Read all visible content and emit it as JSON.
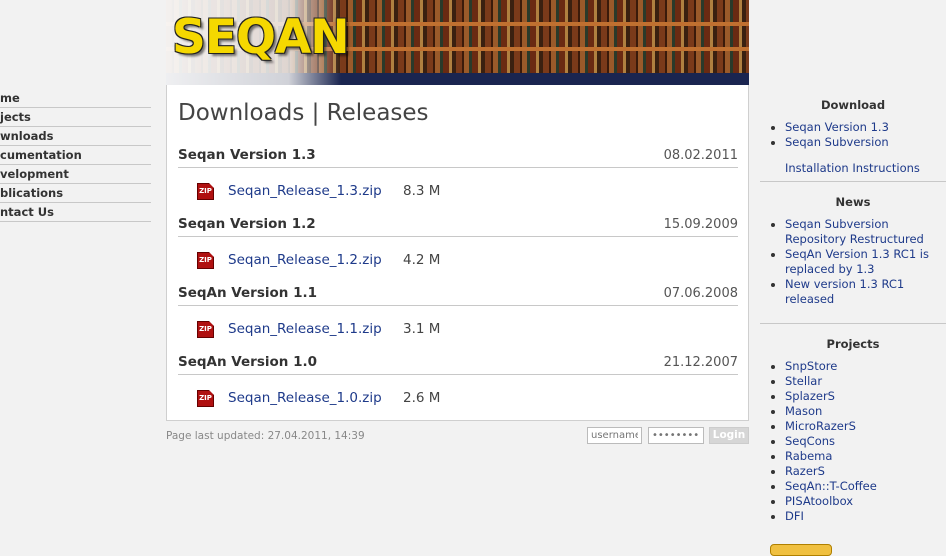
{
  "nav": {
    "items": [
      {
        "label": "Home",
        "clip": "me"
      },
      {
        "label": "Projects",
        "clip": "jects"
      },
      {
        "label": "Downloads",
        "clip": "wnloads"
      },
      {
        "label": "Documentation",
        "clip": "cumentation"
      },
      {
        "label": "Development",
        "clip": "velopment"
      },
      {
        "label": "Publications",
        "clip": "blications"
      },
      {
        "label": "Contact Us",
        "clip": "ntact Us"
      }
    ]
  },
  "banner": {
    "logo_text": "SEQAN"
  },
  "main": {
    "title": "Downloads | Releases",
    "releases": [
      {
        "name": "Seqan Version 1.3",
        "date": "08.02.2011",
        "file": "Seqan_Release_1.3.zip",
        "size": "8.3 M",
        "icon": "zip-icon"
      },
      {
        "name": "Seqan Version 1.2",
        "date": "15.09.2009",
        "file": "Seqan_Release_1.2.zip",
        "size": "4.2 M",
        "icon": "zip-icon"
      },
      {
        "name": "SeqAn Version 1.1",
        "date": "07.06.2008",
        "file": "Seqan_Release_1.1.zip",
        "size": "3.1 M",
        "icon": "zip-icon"
      },
      {
        "name": "SeqAn Version 1.0",
        "date": "21.12.2007",
        "file": "Seqan_Release_1.0.zip",
        "size": "2.6 M",
        "icon": "zip-icon"
      }
    ],
    "zip_icon_text": "ZIP"
  },
  "footer": {
    "last_updated": "Page last updated: 27.04.2011, 14:39",
    "username_placeholder": "username",
    "password_placeholder": "••••••••",
    "login_label": "Login"
  },
  "sidebar": {
    "download": {
      "title": "Download",
      "items": [
        "Seqan Version 1.3",
        "Seqan Subversion"
      ],
      "extra_link": "Installation Instructions"
    },
    "news": {
      "title": "News",
      "items": [
        "Seqan Subversion Repository Restructured",
        "SeqAn Version 1.3 RC1 is replaced by 1.3",
        "New version 1.3 RC1 released"
      ]
    },
    "projects": {
      "title": "Projects",
      "items": [
        "SnpStore",
        "Stellar",
        "SplazerS",
        "Mason",
        "MicroRazerS",
        "SeqCons",
        "Rabema",
        "RazerS",
        "SeqAn::T-Coffee",
        "PISAtoolbox",
        "DFI"
      ]
    }
  },
  "colors": {
    "link": "#1e3a8a",
    "logo_yellow": "#f5d800",
    "banner_band": "#1a2550"
  }
}
